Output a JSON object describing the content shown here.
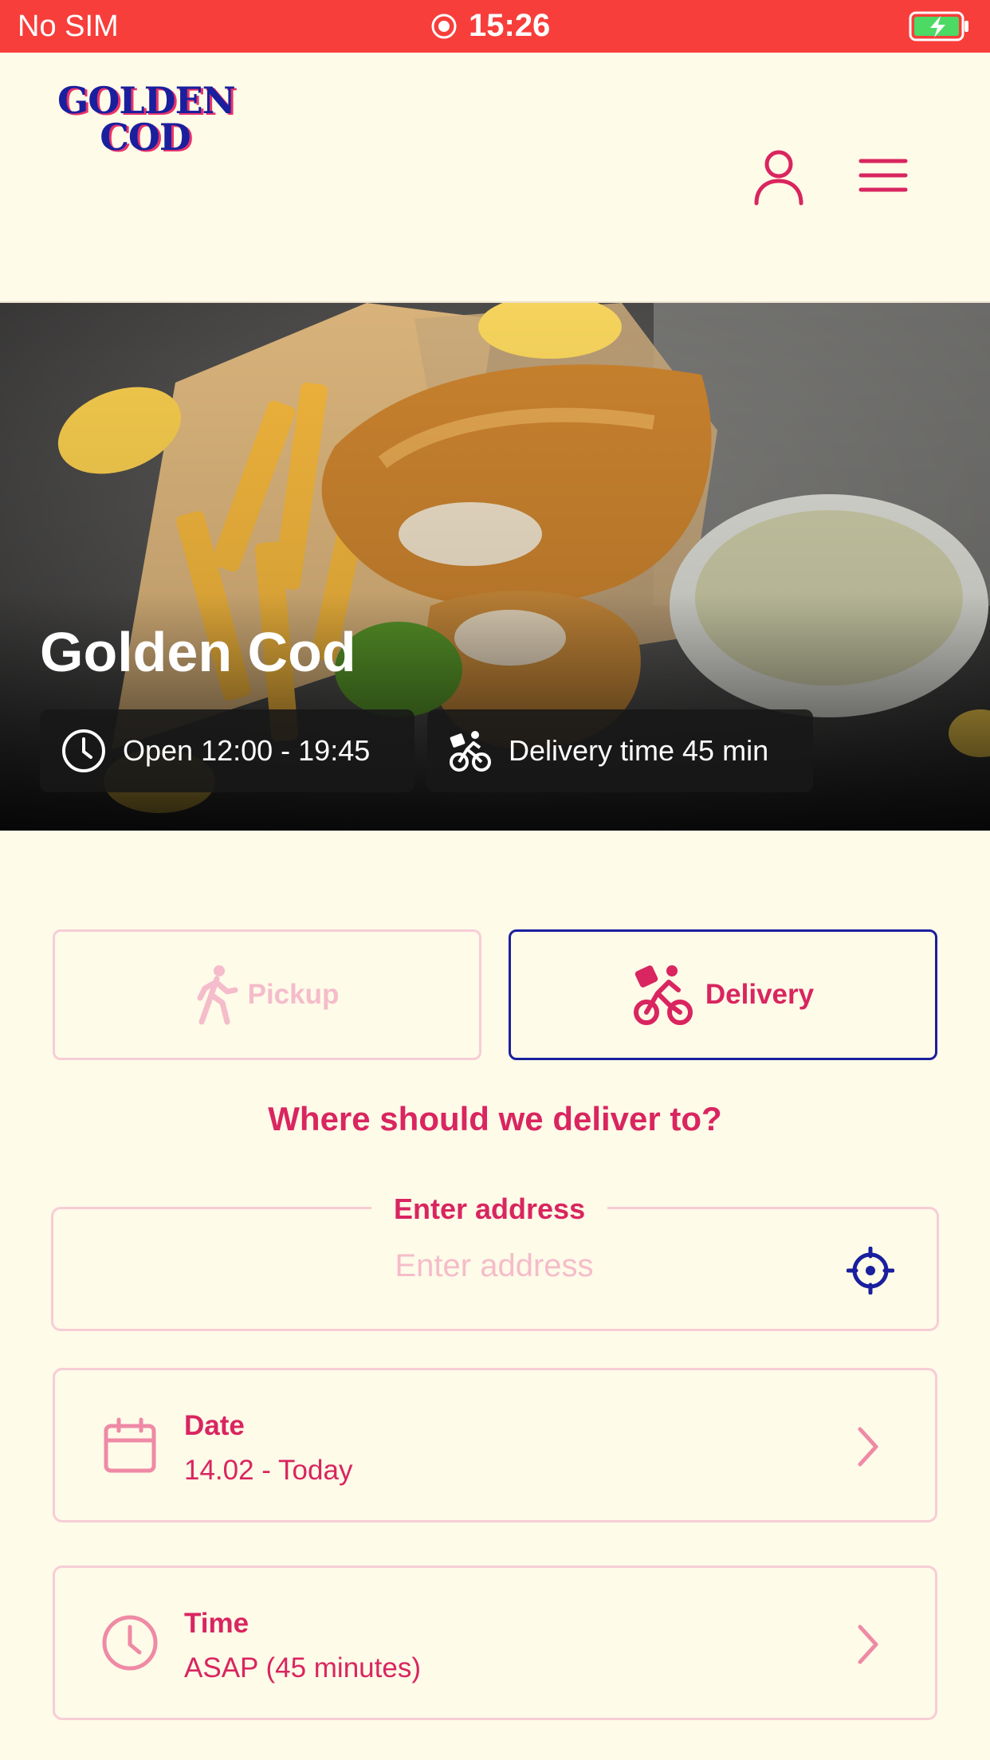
{
  "status_bar": {
    "carrier": "No SIM",
    "time": "15:26"
  },
  "header": {
    "logo_line1": "GOLDEN",
    "logo_line2": "COD"
  },
  "hero": {
    "title": "Golden Cod",
    "hours": "Open 12:00 - 19:45",
    "delivery_time": "Delivery time 45 min"
  },
  "mode": {
    "pickup_label": "Pickup",
    "delivery_label": "Delivery",
    "selected": "Delivery"
  },
  "form": {
    "question": "Where should we deliver to?",
    "address_label": "Enter address",
    "address_placeholder": "Enter address",
    "address_value": ""
  },
  "date_picker": {
    "label": "Date",
    "value": "14.02 - Today"
  },
  "time_picker": {
    "label": "Time",
    "value": "ASAP (45 minutes)"
  },
  "colors": {
    "status_bar": "#f73e3b",
    "background": "#fefbe8",
    "accent_pink": "#d92560",
    "accent_navy": "#1a1f9e",
    "border_light": "#f7cdd7"
  },
  "icons": [
    "record-icon",
    "battery-charging-icon",
    "user-icon",
    "hamburger-menu-icon",
    "clock-icon",
    "bicycle-icon",
    "walking-person-icon",
    "delivery-bike-icon",
    "crosshair-icon",
    "calendar-icon",
    "chevron-right-icon"
  ]
}
